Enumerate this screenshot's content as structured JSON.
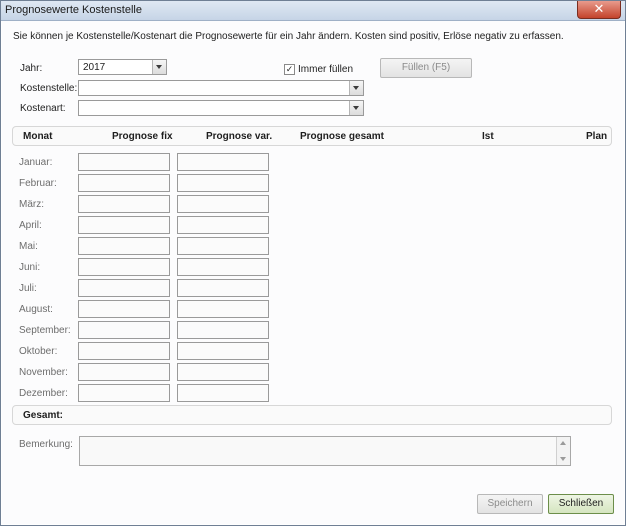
{
  "window": {
    "title": "Prognosewerte Kostenstelle",
    "close_glyph": "✕"
  },
  "intro": "Sie können je Kostenstelle/Kostenart die Prognosewerte für ein Jahr ändern. Kosten sind positiv, Erlöse negativ zu erfassen.",
  "form": {
    "jahr_label": "Jahr:",
    "jahr_value": "2017",
    "kostenstelle_label": "Kostenstelle:",
    "kostenstelle_value": "",
    "kostenart_label": "Kostenart:",
    "kostenart_value": "",
    "immer_fuellen_label": "Immer füllen",
    "immer_fuellen_checked": "✓",
    "fuellen_button": "Füllen (F5)"
  },
  "table": {
    "headers": [
      "Monat",
      "Prognose fix",
      "Prognose var.",
      "Prognose gesamt",
      "Ist",
      "Plan"
    ],
    "months": [
      "Januar:",
      "Februar:",
      "März:",
      "April:",
      "Mai:",
      "Juni:",
      "Juli:",
      "August:",
      "September:",
      "Oktober:",
      "November:",
      "Dezember:"
    ],
    "gesamt_label": "Gesamt:"
  },
  "bemerkung_label": "Bemerkung:",
  "buttons": {
    "speichern": "Speichern",
    "schliessen": "Schließen"
  }
}
